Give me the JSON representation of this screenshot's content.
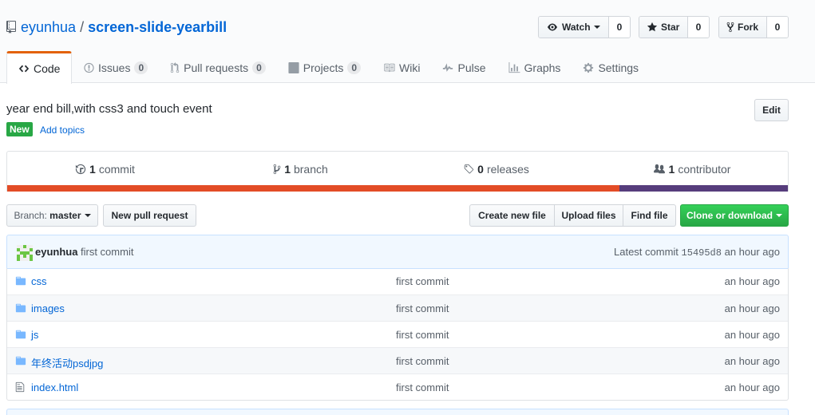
{
  "repo": {
    "owner": "eyunhua",
    "separator": "/",
    "name": "screen-slide-yearbill"
  },
  "actions": {
    "watch": {
      "label": "Watch",
      "count": "0"
    },
    "star": {
      "label": "Star",
      "count": "0"
    },
    "fork": {
      "label": "Fork",
      "count": "0"
    }
  },
  "nav": {
    "code": "Code",
    "issues": {
      "label": "Issues",
      "count": "0"
    },
    "pulls": {
      "label": "Pull requests",
      "count": "0"
    },
    "projects": {
      "label": "Projects",
      "count": "0"
    },
    "wiki": "Wiki",
    "pulse": "Pulse",
    "graphs": "Graphs",
    "settings": "Settings"
  },
  "description": "year end bill,with css3 and touch event",
  "edit_label": "Edit",
  "new_label": "New",
  "add_topics": "Add topics",
  "summary": {
    "commits": {
      "count": "1",
      "label": "commit"
    },
    "branches": {
      "count": "1",
      "label": "branch"
    },
    "releases": {
      "count": "0",
      "label": "releases"
    },
    "contributors": {
      "count": "1",
      "label": "contributor"
    }
  },
  "languages": [
    {
      "color": "#e34c26",
      "share": 78.4
    },
    {
      "color": "#563d7c",
      "share": 21.6
    }
  ],
  "branch": {
    "prefix": "Branch:",
    "name": "master"
  },
  "buttons": {
    "new_pr": "New pull request",
    "create_file": "Create new file",
    "upload": "Upload files",
    "find": "Find file",
    "clone": "Clone or download"
  },
  "latest_commit": {
    "author": "eyunhua",
    "message": "first commit",
    "prefix": "Latest commit",
    "sha": "15495d8",
    "age": "an hour ago"
  },
  "files": [
    {
      "name": "css",
      "type": "dir",
      "message": "first commit",
      "age": "an hour ago"
    },
    {
      "name": "images",
      "type": "dir",
      "message": "first commit",
      "age": "an hour ago"
    },
    {
      "name": "js",
      "type": "dir",
      "message": "first commit",
      "age": "an hour ago"
    },
    {
      "name": "年终活动psdjpg",
      "type": "dir",
      "message": "first commit",
      "age": "an hour ago"
    },
    {
      "name": "index.html",
      "type": "file",
      "message": "first commit",
      "age": "an hour ago"
    }
  ],
  "colors": {
    "link": "#0366d6",
    "selected_tab_border": "#e36209",
    "new_badge": "#28a745",
    "clone_button": "#28a745",
    "folder_icon": "#79b8ff"
  },
  "icons": {
    "repo": "repo-book-icon",
    "watch": "eye-icon",
    "star": "star-icon",
    "fork": "fork-icon",
    "code": "code-icon",
    "issues": "issue-icon",
    "pulls": "pull-request-icon",
    "projects": "project-icon",
    "wiki": "book-icon",
    "pulse": "pulse-icon",
    "graphs": "graph-icon",
    "settings": "gear-icon",
    "commits": "history-icon",
    "branches": "branch-icon",
    "releases": "tag-icon",
    "contributors": "people-icon",
    "folder": "folder-icon",
    "file": "file-icon"
  }
}
